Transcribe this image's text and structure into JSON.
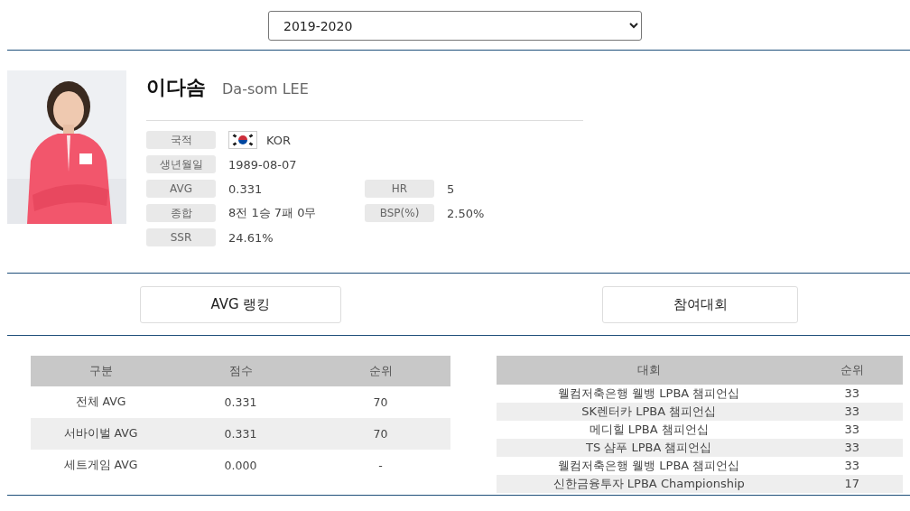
{
  "season_select": {
    "value": "2019-2020"
  },
  "player": {
    "name_ko": "이다솜",
    "name_en": "Da-som LEE",
    "info": [
      {
        "label": "국적",
        "value": "KOR",
        "kind": "flag"
      },
      {
        "label": "생년월일",
        "value": "1989-08-07",
        "kind": "text"
      },
      {
        "label": "AVG",
        "value": "0.331",
        "kind": "text",
        "right": {
          "label": "HR",
          "value": "5"
        }
      },
      {
        "label": "종합",
        "value": "8전 1승 7패 0무",
        "kind": "text",
        "right": {
          "label": "BSP(%)",
          "value": "2.50%"
        }
      },
      {
        "label": "SSR",
        "value": "24.61%",
        "kind": "text"
      }
    ]
  },
  "section_buttons": [
    "AVG 랭킹",
    "참여대회"
  ],
  "avg_table": {
    "columns": [
      "구분",
      "점수",
      "순위"
    ],
    "rows": [
      [
        "전체 AVG",
        "0.331",
        "70"
      ],
      [
        "서바이벌 AVG",
        "0.331",
        "70"
      ],
      [
        "세트게임 AVG",
        "0.000",
        "-"
      ]
    ]
  },
  "tournament_table": {
    "columns": [
      "대회",
      "순위"
    ],
    "rows": [
      [
        "웰컴저축은행 웰뱅 LPBA 챔피언십",
        "33"
      ],
      [
        "SK렌터카 LPBA 챔피언십",
        "33"
      ],
      [
        "메디힐 LPBA 챔피언십",
        "33"
      ],
      [
        "TS 샴푸 LPBA 챔피언십",
        "33"
      ],
      [
        "웰컴저축은행 웰뱅 LPBA 챔피언십",
        "33"
      ],
      [
        "신한금융투자 LPBA Championship",
        "17"
      ]
    ]
  }
}
